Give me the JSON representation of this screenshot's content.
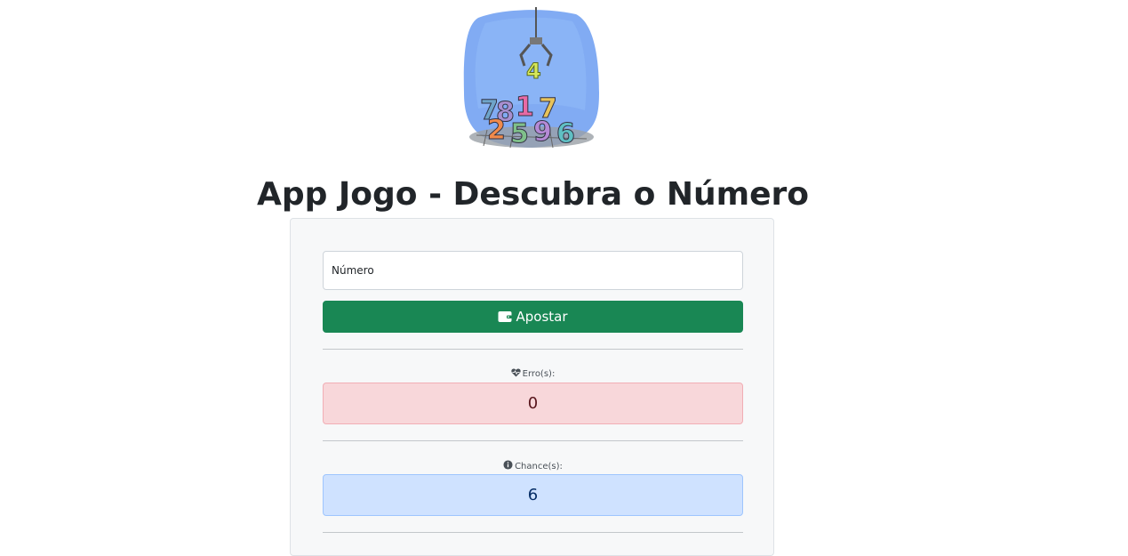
{
  "header": {
    "logo_icon": "claw-machine-numbers-logo",
    "title": "App Jogo - Descubra o Número"
  },
  "form": {
    "input_placeholder": "Número",
    "input_value": "",
    "bet_button_label": "Apostar",
    "bet_button_icon": "wallet-icon"
  },
  "stats": {
    "errors": {
      "label": "Erro(s):",
      "icon": "heart-pulse-icon",
      "value": "0"
    },
    "chances": {
      "label": "Chance(s):",
      "icon": "info-circle-icon",
      "value": "6"
    }
  },
  "colors": {
    "success": "#198754",
    "danger_bg": "#f8d7da",
    "info_bg": "#cfe2ff"
  }
}
